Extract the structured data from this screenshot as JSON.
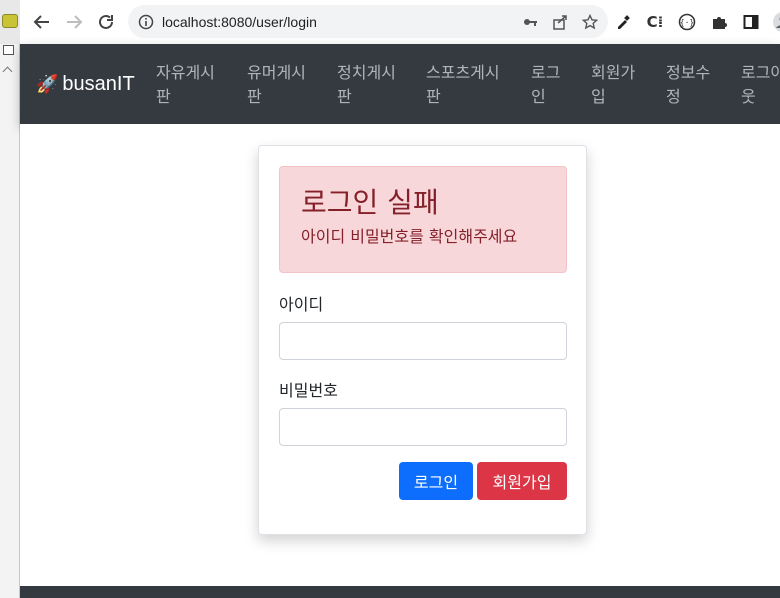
{
  "browser": {
    "url": "localhost:8080/user/login"
  },
  "navbar": {
    "brand": "busanIT",
    "items": [
      {
        "line1": "자유게시",
        "line2": "판"
      },
      {
        "line1": "유머게시",
        "line2": "판"
      },
      {
        "line1": "정치게시",
        "line2": "판"
      },
      {
        "line1": "스포츠게시",
        "line2": "판"
      },
      {
        "line1": "로그",
        "line2": "인"
      },
      {
        "line1": "회원가",
        "line2": "입"
      },
      {
        "line1": "정보수",
        "line2": "정"
      },
      {
        "line1": "로그아",
        "line2": "웃"
      }
    ]
  },
  "alert": {
    "title": "로그인 실패",
    "message": "아이디 비밀번호를 확인해주세요"
  },
  "form": {
    "username_label": "아이디",
    "username_value": "",
    "password_label": "비밀번호",
    "password_value": "",
    "login_button": "로그인",
    "signup_button": "회원가입"
  },
  "colors": {
    "navbar_bg": "#343a40",
    "alert_bg": "#f8d7da",
    "alert_text": "#842029",
    "primary": "#0d6efd",
    "danger": "#dc3545"
  }
}
